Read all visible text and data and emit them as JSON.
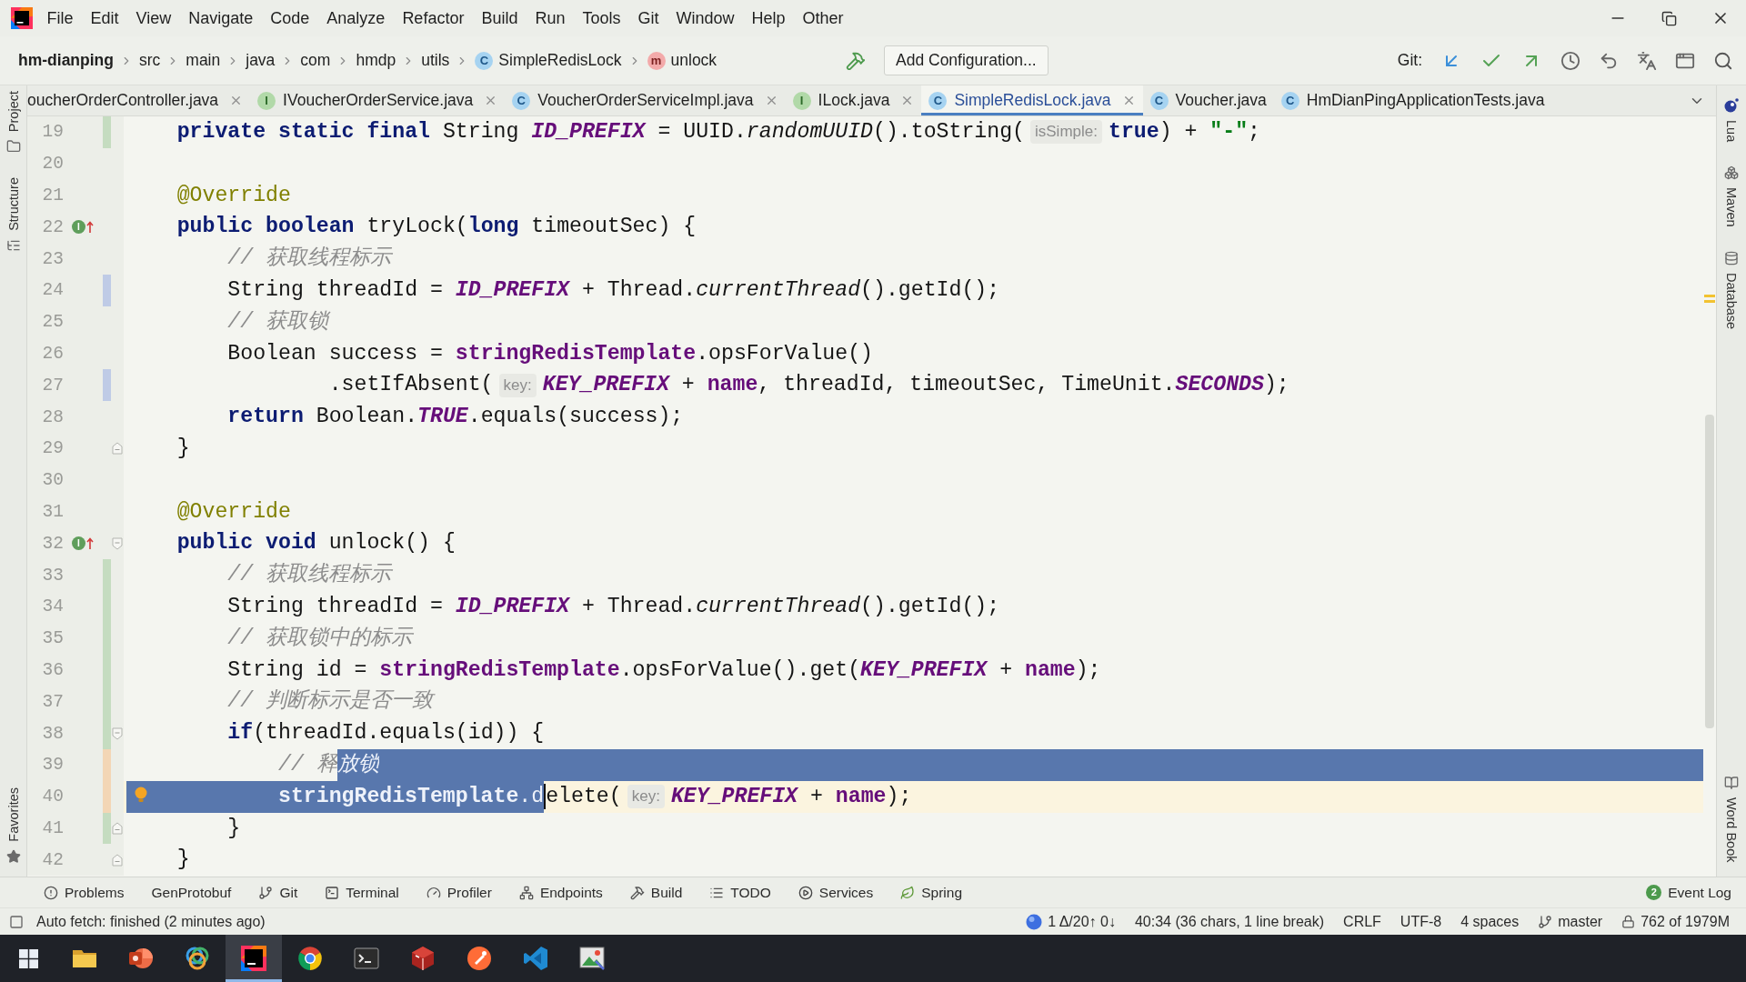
{
  "menu": [
    "File",
    "Edit",
    "View",
    "Navigate",
    "Code",
    "Analyze",
    "Refactor",
    "Build",
    "Run",
    "Tools",
    "Git",
    "Window",
    "Help",
    "Other"
  ],
  "navbar": {
    "crumbs": [
      {
        "label": "hm-dianping",
        "kind": "module"
      },
      {
        "label": "src",
        "kind": "folder"
      },
      {
        "label": "main",
        "kind": "folder"
      },
      {
        "label": "java",
        "kind": "folder"
      },
      {
        "label": "com",
        "kind": "folder"
      },
      {
        "label": "hmdp",
        "kind": "folder"
      },
      {
        "label": "utils",
        "kind": "folder"
      },
      {
        "label": "SimpleRedisLock",
        "kind": "class",
        "badge": "C"
      },
      {
        "label": "unlock",
        "kind": "method",
        "badge": "m"
      }
    ],
    "run_configuration": "Add Configuration...",
    "vcs_label": "Git:"
  },
  "tabs": [
    {
      "label": "oucherOrderController.java",
      "selected": false,
      "closable": true
    },
    {
      "label": "IVoucherOrderService.java",
      "kind": "interface",
      "badge": "I",
      "selected": false,
      "closable": true
    },
    {
      "label": "VoucherOrderServiceImpl.java",
      "kind": "class",
      "badge": "C",
      "selected": false,
      "closable": true
    },
    {
      "label": "ILock.java",
      "kind": "interface",
      "badge": "I",
      "selected": false,
      "closable": true
    },
    {
      "label": "SimpleRedisLock.java",
      "kind": "class",
      "badge": "C",
      "selected": true,
      "closable": true
    },
    {
      "label": "Voucher.java",
      "kind": "class",
      "badge": "C",
      "selected": false,
      "closable": false
    },
    {
      "label": "HmDianPingApplicationTests.java",
      "kind": "class",
      "badge": "C",
      "selected": false,
      "closable": false
    }
  ],
  "left_tools": [
    {
      "label": "Project",
      "kind": "project"
    },
    {
      "label": "Structure",
      "kind": "structure"
    }
  ],
  "left_bottom_tools": [
    {
      "label": "Favorites",
      "kind": "favorites"
    }
  ],
  "right_tools": [
    {
      "label": "Lua",
      "kind": "lua"
    },
    {
      "label": "Maven",
      "kind": "maven"
    },
    {
      "label": "Database",
      "kind": "database"
    }
  ],
  "right_bottom_tools": [
    {
      "label": "Word Book",
      "kind": "wordbook"
    }
  ],
  "editor": {
    "lines": [
      {
        "number": "19",
        "change_marker": {
          "kind": "added"
        },
        "current": false,
        "segments": [
          {
            "selected": false,
            "tokens": [
              {
                "kind": "keyword",
                "text": "    private static final"
              },
              {
                "kind": "plain",
                "text": " String "
              },
              {
                "kind": "constant",
                "text": "ID_PREFIX"
              },
              {
                "kind": "plain",
                "text": " = UUID."
              },
              {
                "kind": "static_call",
                "text": "randomUUID"
              },
              {
                "kind": "plain",
                "text": "().toString("
              },
              {
                "kind": "hint",
                "text": "isSimple:"
              },
              {
                "kind": "keyword",
                "text": "true"
              },
              {
                "kind": "plain",
                "text": ") + "
              },
              {
                "kind": "string",
                "text": "\"-\""
              },
              {
                "kind": "plain",
                "text": ";"
              }
            ]
          }
        ]
      },
      {
        "number": "20",
        "current": false
      },
      {
        "number": "21",
        "current": false,
        "segments": [
          {
            "selected": false,
            "tokens": [
              {
                "kind": "annotation",
                "text": "    @Override"
              }
            ]
          }
        ]
      },
      {
        "number": "22",
        "current": false,
        "marker": {
          "kind": "implements",
          "badge": "I"
        },
        "segments": [
          {
            "selected": false,
            "tokens": [
              {
                "kind": "keyword",
                "text": "    public boolean"
              },
              {
                "kind": "plain",
                "text": " tryLock("
              },
              {
                "kind": "keyword",
                "text": "long"
              },
              {
                "kind": "plain",
                "text": " timeoutSec) {"
              }
            ]
          }
        ]
      },
      {
        "number": "23",
        "current": false,
        "segments": [
          {
            "selected": false,
            "tokens": [
              {
                "kind": "comment",
                "text": "        // 获取线程标示"
              }
            ]
          }
        ]
      },
      {
        "number": "24",
        "change_marker": {
          "kind": "modified"
        },
        "current": false,
        "segments": [
          {
            "selected": false,
            "tokens": [
              {
                "kind": "plain",
                "text": "        String threadId = "
              },
              {
                "kind": "constant",
                "text": "ID_PREFIX"
              },
              {
                "kind": "plain",
                "text": " + Thread."
              },
              {
                "kind": "static_call",
                "text": "currentThread"
              },
              {
                "kind": "plain",
                "text": "().getId();"
              }
            ]
          }
        ]
      },
      {
        "number": "25",
        "current": false,
        "segments": [
          {
            "selected": false,
            "tokens": [
              {
                "kind": "comment",
                "text": "        // 获取锁"
              }
            ]
          }
        ]
      },
      {
        "number": "26",
        "current": false,
        "segments": [
          {
            "selected": false,
            "tokens": [
              {
                "kind": "plain",
                "text": "        Boolean success = "
              },
              {
                "kind": "field",
                "text": "stringRedisTemplate"
              },
              {
                "kind": "plain",
                "text": ".opsForValue()"
              }
            ]
          }
        ]
      },
      {
        "number": "27",
        "change_marker": {
          "kind": "modified"
        },
        "current": false,
        "segments": [
          {
            "selected": false,
            "tokens": [
              {
                "kind": "plain",
                "text": "                .setIfAbsent("
              },
              {
                "kind": "hint",
                "text": "key:"
              },
              {
                "kind": "constant",
                "text": "KEY_PREFIX"
              },
              {
                "kind": "plain",
                "text": " + "
              },
              {
                "kind": "field",
                "text": "name"
              },
              {
                "kind": "plain",
                "text": ", threadId, timeoutSec, TimeUnit."
              },
              {
                "kind": "constant",
                "text": "SECONDS"
              },
              {
                "kind": "plain",
                "text": ");"
              }
            ]
          }
        ]
      },
      {
        "number": "28",
        "current": false,
        "segments": [
          {
            "selected": false,
            "tokens": [
              {
                "kind": "keyword",
                "text": "        return"
              },
              {
                "kind": "plain",
                "text": " Boolean."
              },
              {
                "kind": "constant",
                "text": "TRUE"
              },
              {
                "kind": "plain",
                "text": ".equals(success);"
              }
            ]
          }
        ]
      },
      {
        "number": "29",
        "fold_marker": {
          "kind": "end"
        },
        "current": false,
        "segments": [
          {
            "selected": false,
            "tokens": [
              {
                "kind": "plain",
                "text": "    }"
              }
            ]
          }
        ]
      },
      {
        "number": "30",
        "current": false
      },
      {
        "number": "31",
        "current": false,
        "segments": [
          {
            "selected": false,
            "tokens": [
              {
                "kind": "annotation",
                "text": "    @Override"
              }
            ]
          }
        ]
      },
      {
        "number": "32",
        "fold_marker": {
          "kind": "start"
        },
        "current": false,
        "marker": {
          "kind": "implements",
          "badge": "I"
        },
        "segments": [
          {
            "selected": false,
            "tokens": [
              {
                "kind": "keyword",
                "text": "    public void"
              },
              {
                "kind": "plain",
                "text": " unlock() {"
              }
            ]
          }
        ]
      },
      {
        "number": "33",
        "change_marker": {
          "kind": "added"
        },
        "current": false,
        "segments": [
          {
            "selected": false,
            "tokens": [
              {
                "kind": "comment",
                "text": "        // 获取线程标示"
              }
            ]
          }
        ]
      },
      {
        "number": "34",
        "change_marker": {
          "kind": "added"
        },
        "current": false,
        "segments": [
          {
            "selected": false,
            "tokens": [
              {
                "kind": "plain",
                "text": "        String threadId = "
              },
              {
                "kind": "constant",
                "text": "ID_PREFIX"
              },
              {
                "kind": "plain",
                "text": " + Thread."
              },
              {
                "kind": "static_call",
                "text": "currentThread"
              },
              {
                "kind": "plain",
                "text": "().getId();"
              }
            ]
          }
        ]
      },
      {
        "number": "35",
        "change_marker": {
          "kind": "added"
        },
        "current": false,
        "segments": [
          {
            "selected": false,
            "tokens": [
              {
                "kind": "comment",
                "text": "        // 获取锁中的标示"
              }
            ]
          }
        ]
      },
      {
        "number": "36",
        "change_marker": {
          "kind": "added"
        },
        "current": false,
        "segments": [
          {
            "selected": false,
            "tokens": [
              {
                "kind": "plain",
                "text": "        String id = "
              },
              {
                "kind": "field",
                "text": "stringRedisTemplate"
              },
              {
                "kind": "plain",
                "text": ".opsForValue().get("
              },
              {
                "kind": "constant",
                "text": "KEY_PREFIX"
              },
              {
                "kind": "plain",
                "text": " + "
              },
              {
                "kind": "field",
                "text": "name"
              },
              {
                "kind": "plain",
                "text": ");"
              }
            ]
          }
        ]
      },
      {
        "number": "37",
        "change_marker": {
          "kind": "added"
        },
        "current": false,
        "segments": [
          {
            "selected": false,
            "tokens": [
              {
                "kind": "comment",
                "text": "        // 判断标示是否一致"
              }
            ]
          }
        ]
      },
      {
        "number": "38",
        "change_marker": {
          "kind": "added"
        },
        "fold_marker": {
          "kind": "start"
        },
        "current": false,
        "segments": [
          {
            "selected": false,
            "tokens": [
              {
                "kind": "keyword",
                "text": "        if"
              },
              {
                "kind": "plain",
                "text": "(threadId.equals(id)) {"
              }
            ]
          }
        ]
      },
      {
        "number": "39",
        "change_marker": {
          "kind": "marked"
        },
        "current": false,
        "segments": [
          {
            "selected": false,
            "tokens": [
              {
                "kind": "comment",
                "text": "            // 释"
              }
            ]
          },
          {
            "selected": true,
            "tokens": [
              {
                "kind": "comment",
                "text": "放锁"
              }
            ]
          }
        ]
      },
      {
        "number": "40",
        "change_marker": {
          "kind": "marked"
        },
        "current": true,
        "marker": {
          "kind": "bulb"
        },
        "segments": [
          {
            "selected": true,
            "tokens": [
              {
                "kind": "field",
                "text": "            stringRedisTemplate"
              },
              {
                "kind": "plain",
                "text": ".d"
              }
            ]
          },
          {
            "selected": false,
            "tokens": [
              {
                "kind": "plain",
                "text": "elete("
              },
              {
                "kind": "hint",
                "text": "key:"
              },
              {
                "kind": "constant",
                "text": "KEY_PREFIX"
              },
              {
                "kind": "plain",
                "text": " + "
              },
              {
                "kind": "field",
                "text": "name"
              },
              {
                "kind": "plain",
                "text": ");"
              }
            ]
          }
        ]
      },
      {
        "number": "41",
        "change_marker": {
          "kind": "added"
        },
        "fold_marker": {
          "kind": "end"
        },
        "current": false,
        "segments": [
          {
            "selected": false,
            "tokens": [
              {
                "kind": "plain",
                "text": "        }"
              }
            ]
          }
        ]
      },
      {
        "number": "42",
        "fold_marker": {
          "kind": "end"
        },
        "current": false,
        "segments": [
          {
            "selected": false,
            "tokens": [
              {
                "kind": "plain",
                "text": "    }"
              }
            ]
          }
        ]
      }
    ]
  },
  "tool_windows": [
    {
      "label": "Problems",
      "kind": "problems"
    },
    {
      "label": "GenProtobuf",
      "kind": "protobuf"
    },
    {
      "label": "Git",
      "kind": "git"
    },
    {
      "label": "Terminal",
      "kind": "terminal"
    },
    {
      "label": "Profiler",
      "kind": "profiler"
    },
    {
      "label": "Endpoints",
      "kind": "endpoints"
    },
    {
      "label": "Build",
      "kind": "build"
    },
    {
      "label": "TODO",
      "kind": "todo"
    },
    {
      "label": "Services",
      "kind": "services"
    },
    {
      "label": "Spring",
      "kind": "spring"
    }
  ],
  "event_log": {
    "label": "Event Log",
    "badge": "2"
  },
  "status_bar": {
    "message": "Auto fetch: finished (2 minutes ago)",
    "items": [
      {
        "kind": "vcs",
        "text": "1 Δ/20↑ 0↓"
      },
      {
        "kind": "position",
        "text": "40:34 (36 chars, 1 line break)"
      },
      {
        "kind": "line_separator",
        "text": "CRLF"
      },
      {
        "kind": "encoding",
        "text": "UTF-8"
      },
      {
        "kind": "indent",
        "text": "4 spaces"
      },
      {
        "kind": "branch",
        "text": "master"
      },
      {
        "kind": "memory",
        "text": "762 of 1979M"
      }
    ]
  },
  "taskbar": [
    {
      "kind": "start",
      "selected": false
    },
    {
      "kind": "explorer",
      "selected": false
    },
    {
      "kind": "slides",
      "selected": false
    },
    {
      "kind": "rings",
      "selected": false
    },
    {
      "kind": "ide",
      "selected": true
    },
    {
      "kind": "browser",
      "selected": false
    },
    {
      "kind": "terminal",
      "selected": false
    },
    {
      "kind": "database_tool",
      "selected": false
    },
    {
      "kind": "api_client",
      "selected": false
    },
    {
      "kind": "code_editor",
      "selected": false
    },
    {
      "kind": "image_viewer",
      "selected": false
    }
  ]
}
